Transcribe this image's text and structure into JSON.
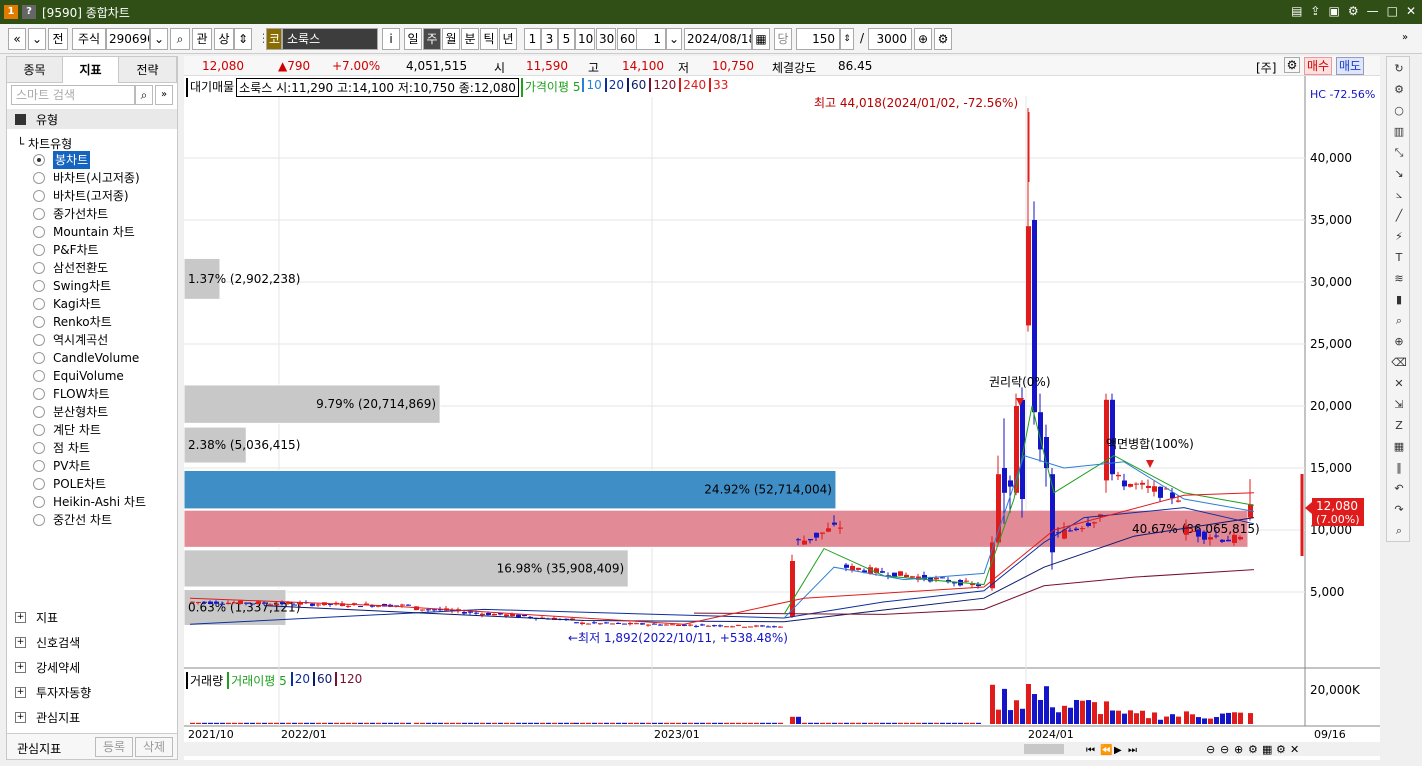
{
  "window": {
    "title": "[9590] 종합차트",
    "icons": [
      "app-icon",
      "help-icon"
    ],
    "controls": [
      "layout-icon",
      "export-icon",
      "print-icon",
      "settings-icon",
      "minimize-icon",
      "maximize-icon",
      "close-icon"
    ]
  },
  "toolbar": {
    "nav_prev": "«",
    "nav_down": "»",
    "jeon": "전",
    "market": "주식",
    "code": "290690",
    "gwan": "관",
    "sang": "상",
    "brand_badge": "코",
    "stock_name": "소룩스",
    "info": "i",
    "periods": [
      "일",
      "주",
      "월",
      "분",
      "틱",
      "년"
    ],
    "active_period": "주",
    "intervals": [
      "1",
      "3",
      "5",
      "10",
      "30",
      "60"
    ],
    "spin_value": "1",
    "date": "2024/08/18",
    "dang": "당",
    "count": "150",
    "slash": "/",
    "max": "3000"
  },
  "left": {
    "tabs": [
      "종목",
      "지표",
      "전략"
    ],
    "active_tab": "지표",
    "search_placeholder": "스마트 검색",
    "section_type": "유형",
    "tree_root": "차트유형",
    "chart_types": [
      "봉차트",
      "바차트(시고저종)",
      "바차트(고저종)",
      "종가선차트",
      "Mountain 차트",
      "P&F차트",
      "삼선전환도",
      "Swing차트",
      "Kagi차트",
      "Renko차트",
      "역시계곡선",
      "CandleVolume",
      "EquiVolume",
      "FLOW차트",
      "분산형차트",
      "계단 차트",
      "점 차트",
      "PV차트",
      "POLE차트",
      "Heikin-Ashi 차트",
      "중간선 차트"
    ],
    "selected": "봉차트",
    "sections": [
      "지표",
      "신호검색",
      "강세약세",
      "투자자동향",
      "관심지표"
    ],
    "footer": {
      "label": "관심지표",
      "register": "등록",
      "delete": "삭제"
    }
  },
  "infobar": {
    "price": "12,080",
    "change": "▲790",
    "pct": "+7.00%",
    "volume": "4,051,515",
    "open_label": "시",
    "open": "11,590",
    "high_label": "고",
    "high": "14,100",
    "low_label": "저",
    "low": "10,750",
    "strength_label": "체결강도",
    "strength": "86.45",
    "unit": "[주]",
    "buy": "매수",
    "sell": "매도"
  },
  "legend": {
    "main": "대기매물",
    "stock": "소룩스 시:11,290 고:14,100 저:10,750 종:12,080",
    "ma_label": "가격이평 5",
    "ma": [
      "10",
      "20",
      "60",
      "120",
      "240",
      "33"
    ],
    "hc": "HC -72.56%"
  },
  "colors": {
    "up": "#e01b1b",
    "down": "#1414c8",
    "ma5": "#1fa01f",
    "ma10": "#2a7fd6",
    "ma20": "#0b2fa0",
    "ma60": "#0a1a6a",
    "ma120": "#7a1030",
    "ma240": "#e01b1b",
    "ma33": "#e01b1b",
    "vp_gray": "#c8c8c8",
    "vp_blue": "#3f8fc6",
    "vp_red": "#e38a97"
  },
  "chart_data": {
    "type": "candlestick",
    "y_ticks": [
      "40,000",
      "35,000",
      "30,000",
      "25,000",
      "20,000",
      "15,000",
      "10,000",
      "5,000"
    ],
    "ylim": [
      0,
      48000
    ],
    "x_ticks": [
      "2021/10",
      "2022/01",
      "2023/01",
      "2024/01"
    ],
    "last_date": "09/16",
    "last_price": "12,080",
    "last_pct": "(7.00%)",
    "annotations": {
      "high": "최고 44,018(2024/01/02, -72.56%)",
      "low": "←최저 1,892(2022/10/11, +538.48%)",
      "rights": "권리락(0%)",
      "merge": "액면병합(100%)",
      "dist": "40.67% (86,065,815)"
    },
    "volume_profile": [
      {
        "label": "1.37% (2,902,238)",
        "price_low": 28600,
        "price_high": 31900,
        "share": 1.37
      },
      {
        "label": "9.79% (20,714,869)",
        "price_low": 18600,
        "price_high": 21700,
        "share": 9.79
      },
      {
        "label": "2.38% (5,036,415)",
        "price_low": 15400,
        "price_high": 18300,
        "share": 2.38
      },
      {
        "label": "24.92% (52,714,004)",
        "price_low": 11700,
        "price_high": 14800,
        "share": 24.92
      },
      {
        "label": "40.67% (86,065,815)",
        "price_low": 8600,
        "price_high": 11600,
        "share": 40.67
      },
      {
        "label": "16.98% (35,908,409)",
        "price_low": 5400,
        "price_high": 8400,
        "share": 16.98
      },
      {
        "label": "0.63% (1,337,121)",
        "price_low": 2300,
        "price_high": 5200,
        "share": 0.63
      }
    ],
    "vol_legend": {
      "label": "거래량",
      "ma_label": "거래이평 5",
      "ma": [
        "20",
        "60",
        "120"
      ]
    },
    "vol_tick": "20,000K"
  }
}
